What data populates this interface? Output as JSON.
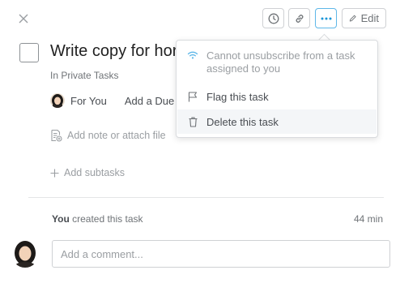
{
  "toolbar": {
    "edit_label": "Edit"
  },
  "task": {
    "title": "Write copy for hor",
    "project": "In Private Tasks",
    "assignee": "For You",
    "due_date": "Add a Due D",
    "note_placeholder": "Add note or attach file",
    "subtasks_label": "Add subtasks"
  },
  "activity": {
    "actor": "You",
    "action": " created this task",
    "time": "44 min"
  },
  "comment": {
    "placeholder": "Add a comment..."
  },
  "menu": {
    "items": [
      {
        "label": "Cannot unsubscribe from a task assigned to you",
        "icon": "wifi-icon",
        "disabled": true
      },
      {
        "label": "Flag this task",
        "icon": "flag-icon",
        "disabled": false
      },
      {
        "label": "Delete this task",
        "icon": "trash-icon",
        "disabled": false
      }
    ]
  },
  "colors": {
    "accent": "#1a96d8",
    "muted_text": "#9a9ea2",
    "border": "#cfd1d4"
  }
}
